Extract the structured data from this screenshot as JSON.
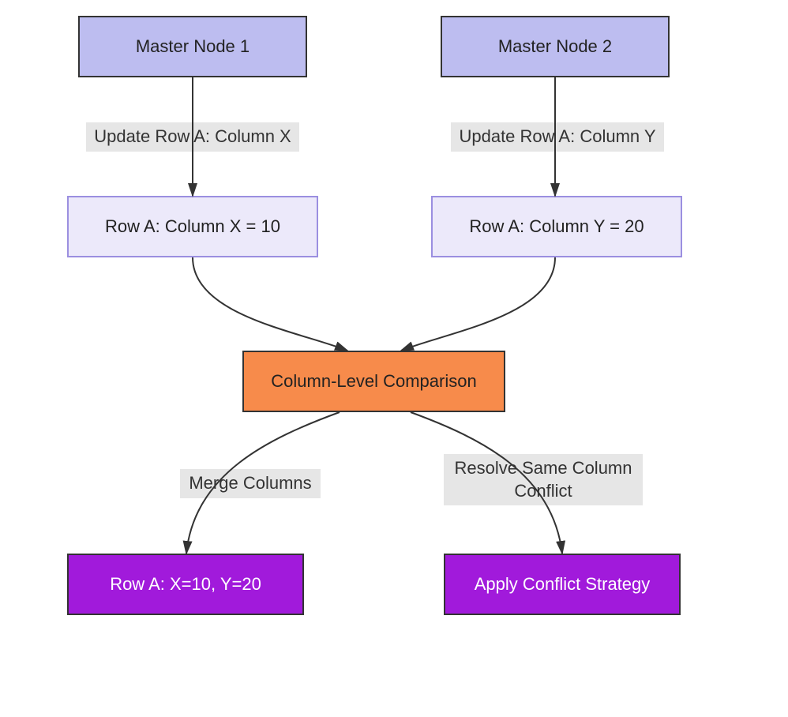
{
  "nodes": {
    "master1": "Master Node 1",
    "master2": "Master Node 2",
    "rowX": "Row A: Column X = 10",
    "rowY": "Row A: Column Y = 20",
    "compare": "Column-Level Comparison",
    "merged": "Row A: X=10, Y=20",
    "strategy": "Apply Conflict Strategy"
  },
  "edges": {
    "updateX": "Update Row A: Column X",
    "updateY": "Update Row A: Column Y",
    "mergeCols": "Merge Columns",
    "resolveConflict": "Resolve Same Column Conflict"
  }
}
